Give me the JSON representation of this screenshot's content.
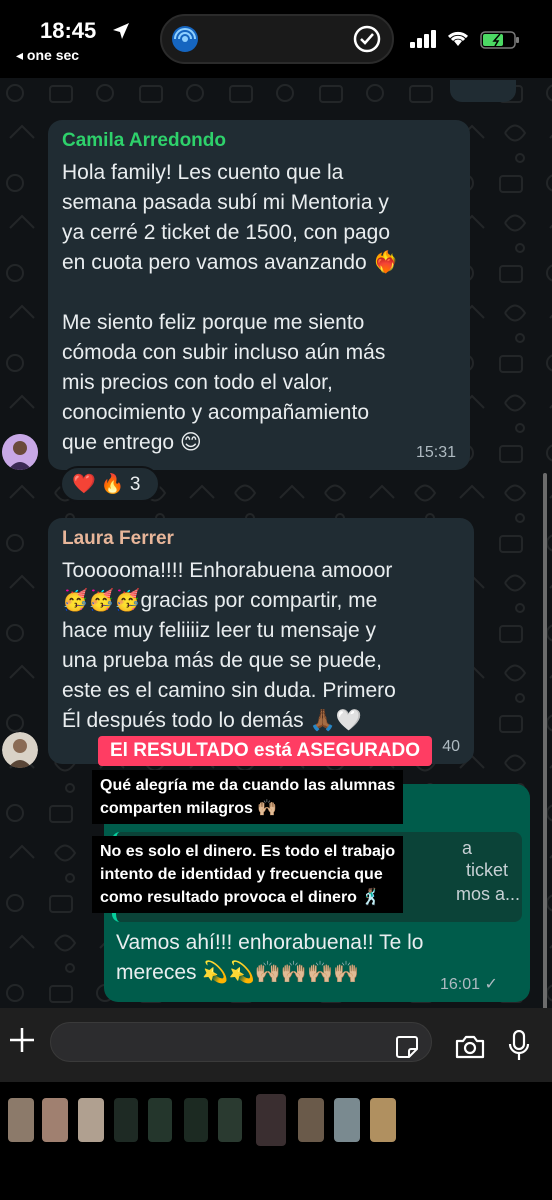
{
  "status_bar": {
    "time": "18:45",
    "back_label": "◂ one sec"
  },
  "messages": {
    "camila": {
      "sender": "Camila Arredondo",
      "text": "Hola family! Les cuento que la\nsemana pasada subí mi Mentoria y\nya cerré 2 ticket de 1500, con pago\nen cuota pero vamos avanzando ❤️‍🔥\n\nMe siento feliz porque me siento\ncómoda con subir incluso aún más\nmis precios con todo el valor,\nconocimiento y acompañamiento\nque entrego 😊",
      "time": "15:31",
      "reactions": "❤️ 🔥 3"
    },
    "laura": {
      "sender": "Laura Ferrer",
      "text": "Toooooma!!!! Enhorabuena amooor\n🥳🥳🥳gracias por compartir, me\nhace muy feliiiiz leer tu mensaje y\nuna prueba más de que se puede,\neste es el camino sin duda. Primero\nÉl después todo lo demás 🙏🏾🤍",
      "time": "40"
    },
    "outgoing": {
      "quote_line1": "a",
      "quote_line2": "ticket",
      "quote_line3": "mos a...",
      "text": "Vamos ahí!!! enhorabuena!! Te lo\nmereces 💫💫🙌🏼🙌🏼🙌🏼🙌🏼",
      "time": "16:01 ✓"
    }
  },
  "overlay": {
    "banner": "El RESULTADO está ASEGURADO",
    "caption1_line1": "Qué alegría me da cuando las alumnas",
    "caption1_line2": "comparten milagros 🙌🏼",
    "caption2_line1": "No es solo el dinero. Es todo el trabajo",
    "caption2_line2": "intento de identidad y frecuencia que",
    "caption2_line3": "como resultado provoca el dinero 🕺🏽"
  },
  "colors": {
    "camila_name": "#2ed16b",
    "laura_name": "#e8b69a",
    "banner": "#ff3d63",
    "outgoing_bubble": "#005c4b",
    "incoming_bubble": "#202c33"
  },
  "icons": [
    "location-arrow-icon",
    "wifi-icon",
    "battery-icon",
    "check-circle-icon",
    "plus-icon",
    "sticker-icon",
    "camera-icon",
    "microphone-icon"
  ]
}
